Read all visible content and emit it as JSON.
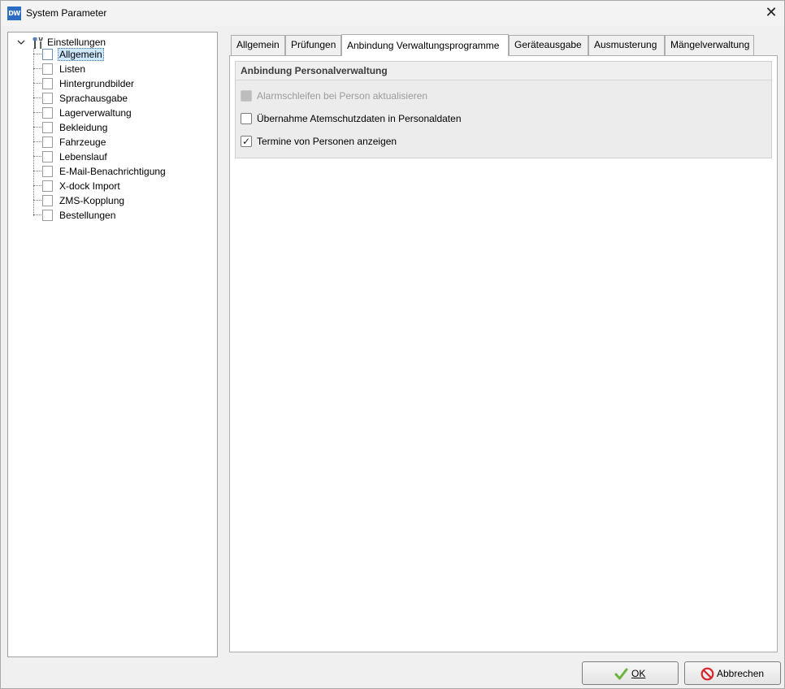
{
  "window": {
    "app_icon_text": "DW",
    "title": "System Parameter",
    "close_glyph": "✕"
  },
  "tree": {
    "root_label": "Einstellungen",
    "root_icon": "tools-icon",
    "items": [
      {
        "label": "Allgemein",
        "selected": true
      },
      {
        "label": "Listen"
      },
      {
        "label": "Hintergrundbilder"
      },
      {
        "label": "Sprachausgabe"
      },
      {
        "label": "Lagerverwaltung"
      },
      {
        "label": "Bekleidung"
      },
      {
        "label": "Fahrzeuge"
      },
      {
        "label": "Lebenslauf"
      },
      {
        "label": "E-Mail-Benachrichtigung"
      },
      {
        "label": "X-dock Import"
      },
      {
        "label": "ZMS-Kopplung"
      },
      {
        "label": "Bestellungen"
      }
    ]
  },
  "tabs": [
    {
      "label": "Allgemein"
    },
    {
      "label": "Prüfungen"
    },
    {
      "label": "Anbindung Verwaltungsprogramme",
      "active": true
    },
    {
      "label": "Geräteausgabe"
    },
    {
      "label": "Ausmusterung"
    },
    {
      "label": "Mängelverwaltung"
    }
  ],
  "panel": {
    "group_title": "Anbindung Personalverwaltung",
    "options": [
      {
        "label": "Alarmschleifen bei Person aktualisieren",
        "checked": false,
        "disabled": true
      },
      {
        "label": "Übernahme Atemschutzdaten in Personaldaten",
        "checked": false,
        "disabled": false
      },
      {
        "label": "Termine von Personen anzeigen",
        "checked": true,
        "disabled": false
      }
    ]
  },
  "buttons": {
    "ok_label": "OK",
    "cancel_label": "Abbrechen",
    "ok_icon": "checkmark-icon",
    "cancel_icon": "cancel-icon"
  },
  "colors": {
    "selection": "#cde8ff",
    "ok_icon": "#6db33f",
    "cancel_icon": "#d8232a"
  }
}
